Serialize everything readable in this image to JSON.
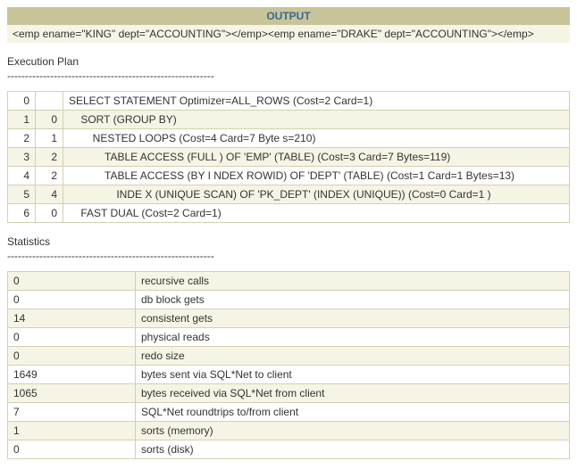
{
  "output": {
    "header": "OUTPUT",
    "row": "<emp ename=\"KING\" dept=\"ACCOUNTING\"></emp><emp ename=\"DRAKE\" dept=\"ACCOUNTING\"></emp>"
  },
  "plan": {
    "label": "Execution Plan",
    "dashes": "----------------------------------------------------------",
    "rows": [
      {
        "id": "0",
        "parent": "",
        "op": "SELECT STATEMENT Optimizer=ALL_ROWS (Cost=2 Card=1)",
        "indent": 0
      },
      {
        "id": "1",
        "parent": "0",
        "op": "SORT (GROUP BY)",
        "indent": 1
      },
      {
        "id": "2",
        "parent": "1",
        "op": "NESTED LOOPS (Cost=4 Card=7 Byte s=210)",
        "indent": 2
      },
      {
        "id": "3",
        "parent": "2",
        "op": "TABLE ACCESS (FULL ) OF 'EMP' (TABLE) (Cost=3 Card=7 Bytes=119)",
        "indent": 3
      },
      {
        "id": "4",
        "parent": "2",
        "op": "TABLE ACCESS (BY I NDEX ROWID) OF 'DEPT' (TABLE) (Cost=1 Card=1 Bytes=13)",
        "indent": 3
      },
      {
        "id": "5",
        "parent": "4",
        "op": "INDE X (UNIQUE SCAN) OF 'PK_DEPT' (INDEX (UNIQUE)) (Cost=0 Card=1 )",
        "indent": 4
      },
      {
        "id": "6",
        "parent": "0",
        "op": "FAST DUAL (Cost=2 Card=1)",
        "indent": 1
      }
    ]
  },
  "stats": {
    "label": "Statistics",
    "dashes": "----------------------------------------------------------",
    "rows": [
      {
        "value": "0",
        "name": "recursive calls"
      },
      {
        "value": "0",
        "name": "db block gets"
      },
      {
        "value": "14",
        "name": "consistent gets"
      },
      {
        "value": "0",
        "name": "physical reads"
      },
      {
        "value": "0",
        "name": "redo size"
      },
      {
        "value": "1649",
        "name": "bytes sent via SQL*Net to client"
      },
      {
        "value": "1065",
        "name": "bytes received via SQL*Net from client"
      },
      {
        "value": "7",
        "name": "SQL*Net roundtrips to/from client"
      },
      {
        "value": "1",
        "name": "sorts (memory)"
      },
      {
        "value": "0",
        "name": "sorts (disk)"
      }
    ]
  }
}
